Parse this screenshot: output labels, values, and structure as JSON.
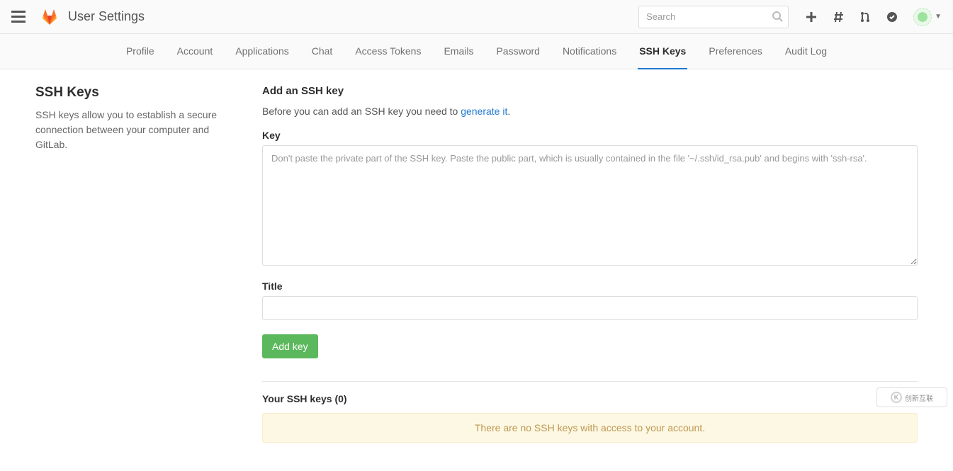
{
  "header": {
    "title": "User Settings",
    "search_placeholder": "Search"
  },
  "tabs": [
    {
      "label": "Profile"
    },
    {
      "label": "Account"
    },
    {
      "label": "Applications"
    },
    {
      "label": "Chat"
    },
    {
      "label": "Access Tokens"
    },
    {
      "label": "Emails"
    },
    {
      "label": "Password"
    },
    {
      "label": "Notifications"
    },
    {
      "label": "SSH Keys",
      "active": true
    },
    {
      "label": "Preferences"
    },
    {
      "label": "Audit Log"
    }
  ],
  "side": {
    "heading": "SSH Keys",
    "description": "SSH keys allow you to establish a secure connection between your computer and GitLab."
  },
  "main": {
    "add_heading": "Add an SSH key",
    "lead_before": "Before you can add an SSH key you need to ",
    "lead_link": "generate it",
    "lead_after": ".",
    "key_label": "Key",
    "key_placeholder": "Don't paste the private part of the SSH key. Paste the public part, which is usually contained in the file '~/.ssh/id_rsa.pub' and begins with 'ssh-rsa'.",
    "title_label": "Title",
    "add_button": "Add key",
    "list_heading": "Your SSH keys (0)",
    "empty_message": "There are no SSH keys with access to your account."
  },
  "watermark": "创新互联"
}
